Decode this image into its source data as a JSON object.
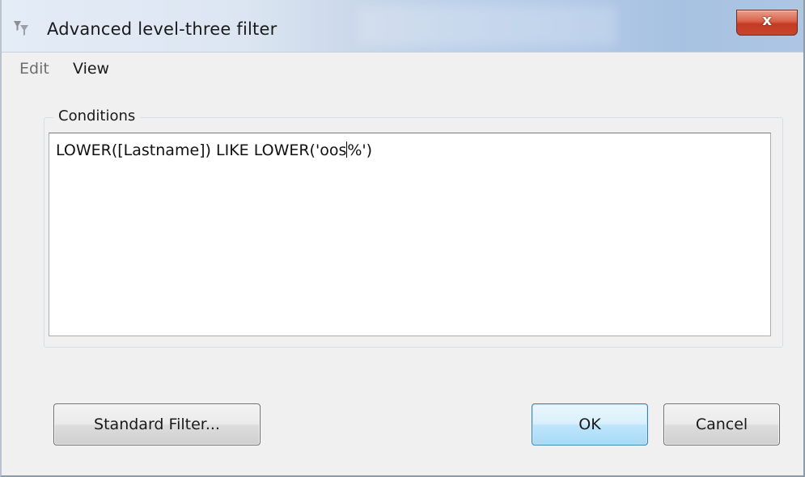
{
  "window": {
    "title": "Advanced level-three filter",
    "close_label": "x"
  },
  "menu": {
    "edit": "Edit",
    "view": "View"
  },
  "conditions": {
    "label": "Conditions",
    "text_before_caret": "LOWER([Lastname]) LIKE LOWER('oos",
    "text_after_caret": "%')"
  },
  "buttons": {
    "standard_filter": "Standard Filter...",
    "ok": "OK",
    "cancel": "Cancel"
  },
  "icons": {
    "app": "filter-funnel-icon",
    "close": "close-icon"
  }
}
